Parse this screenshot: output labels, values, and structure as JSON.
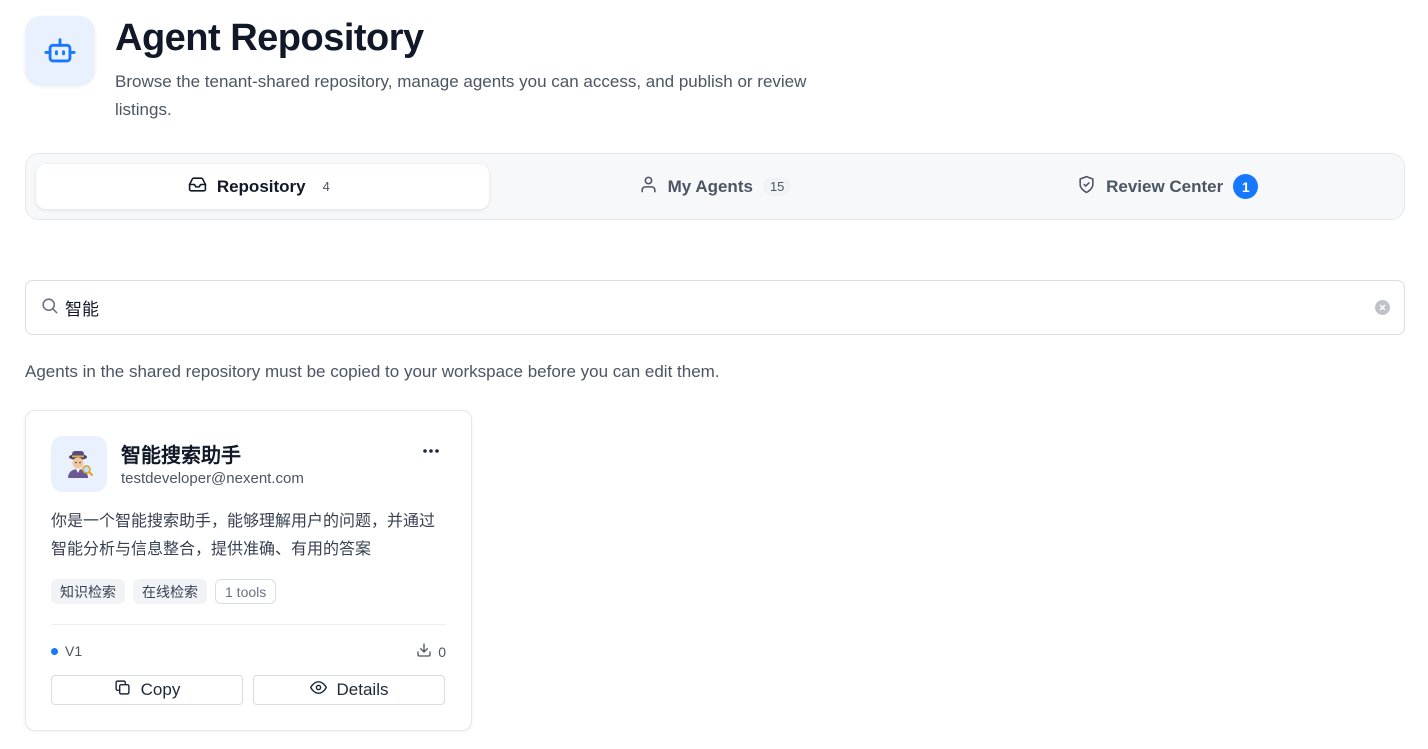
{
  "header": {
    "icon": "robot-icon",
    "title": "Agent Repository",
    "subtitle": "Browse the tenant-shared repository, manage agents you can access, and publish or review listings."
  },
  "tabs": [
    {
      "label": "Repository",
      "count": "4",
      "icon": "inbox-icon",
      "active": true
    },
    {
      "label": "My Agents",
      "count": "15",
      "icon": "user-icon",
      "active": false
    },
    {
      "label": "Review Center",
      "count": "1",
      "icon": "shield-check-icon",
      "active": false
    }
  ],
  "search": {
    "value": "智能",
    "placeholder": ""
  },
  "notice": "Agents in the shared repository must be copied to your workspace before you can edit them.",
  "cards": [
    {
      "avatar": "detective-emoji",
      "title": "智能搜索助手",
      "author": "testdeveloper@nexent.com",
      "description": "你是一个智能搜索助手，能够理解用户的问题，并通过智能分析与信息整合，提供准确、有用的答案",
      "tags": [
        "知识检索",
        "在线检索"
      ],
      "tools_label": "1 tools",
      "version": "V1",
      "downloads": "0",
      "copy_label": "Copy",
      "details_label": "Details"
    }
  ],
  "colors": {
    "accent": "#1677ff",
    "icon_bg": "#e8f1fd"
  }
}
